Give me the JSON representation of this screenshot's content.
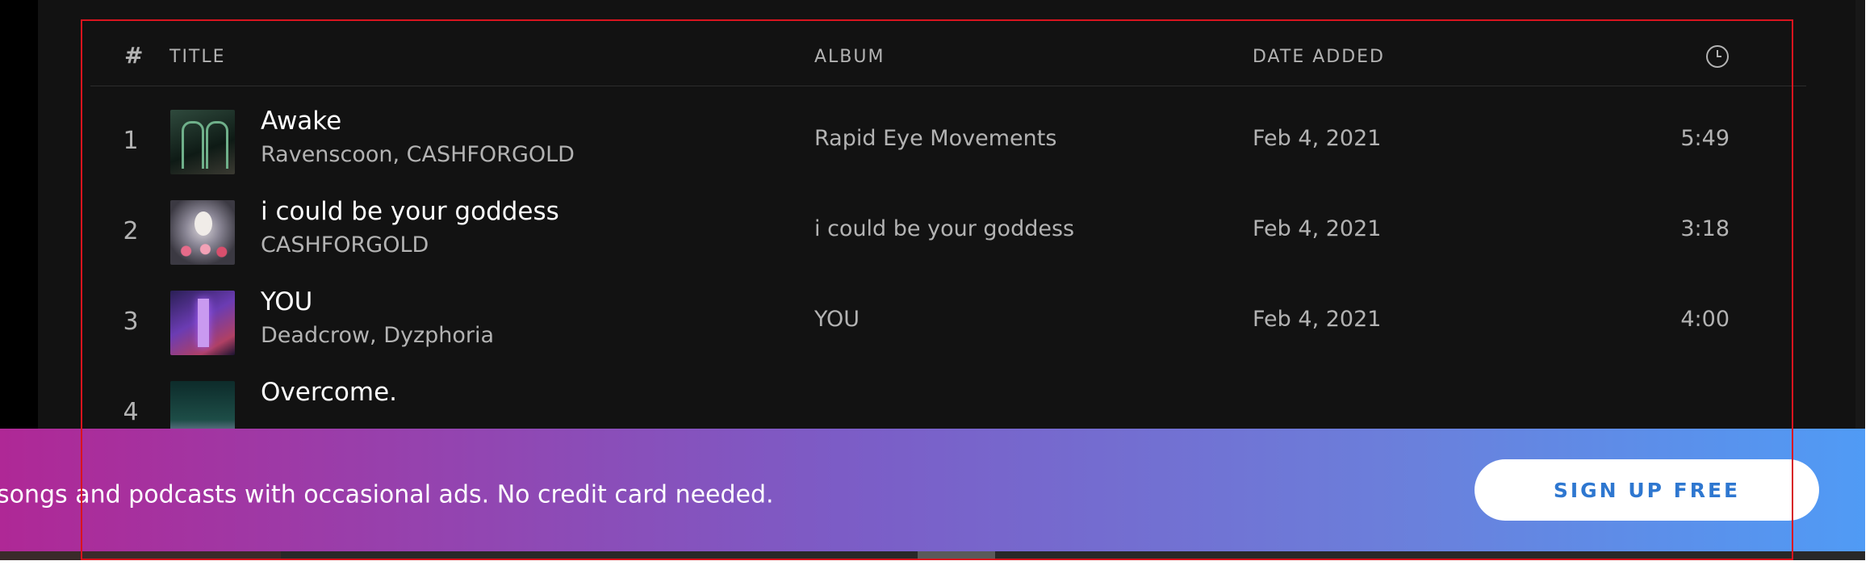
{
  "tracklist": {
    "header": {
      "number": "#",
      "title": "TITLE",
      "album": "ALBUM",
      "date_added": "DATE ADDED",
      "duration_icon": "clock-icon"
    },
    "rows": [
      {
        "number": "1",
        "title": "Awake",
        "artists": "Ravenscoon, CASHFORGOLD",
        "album": "Rapid Eye Movements",
        "date_added": "Feb 4, 2021",
        "duration": "5:49"
      },
      {
        "number": "2",
        "title": "i could be your goddess",
        "artists": "CASHFORGOLD",
        "album": "i could be your goddess",
        "date_added": "Feb 4, 2021",
        "duration": "3:18"
      },
      {
        "number": "3",
        "title": "YOU",
        "artists": "Deadcrow, Dyzphoria",
        "album": "YOU",
        "date_added": "Feb 4, 2021",
        "duration": "4:00"
      },
      {
        "number": "4",
        "title": "Overcome.",
        "artists": "",
        "album": "",
        "date_added": "",
        "duration": ""
      }
    ]
  },
  "promo": {
    "text": "songs and podcasts with occasional ads. No credit card needed.",
    "signup_label": "SIGN UP FREE"
  },
  "colors": {
    "background": "#121212",
    "text_primary": "#ffffff",
    "text_secondary": "#b3b3b3",
    "promo_gradient_start": "#af2896",
    "promo_gradient_end": "#509bf5",
    "signup_text": "#2e77d0",
    "selection_outline": "#d9141e"
  }
}
